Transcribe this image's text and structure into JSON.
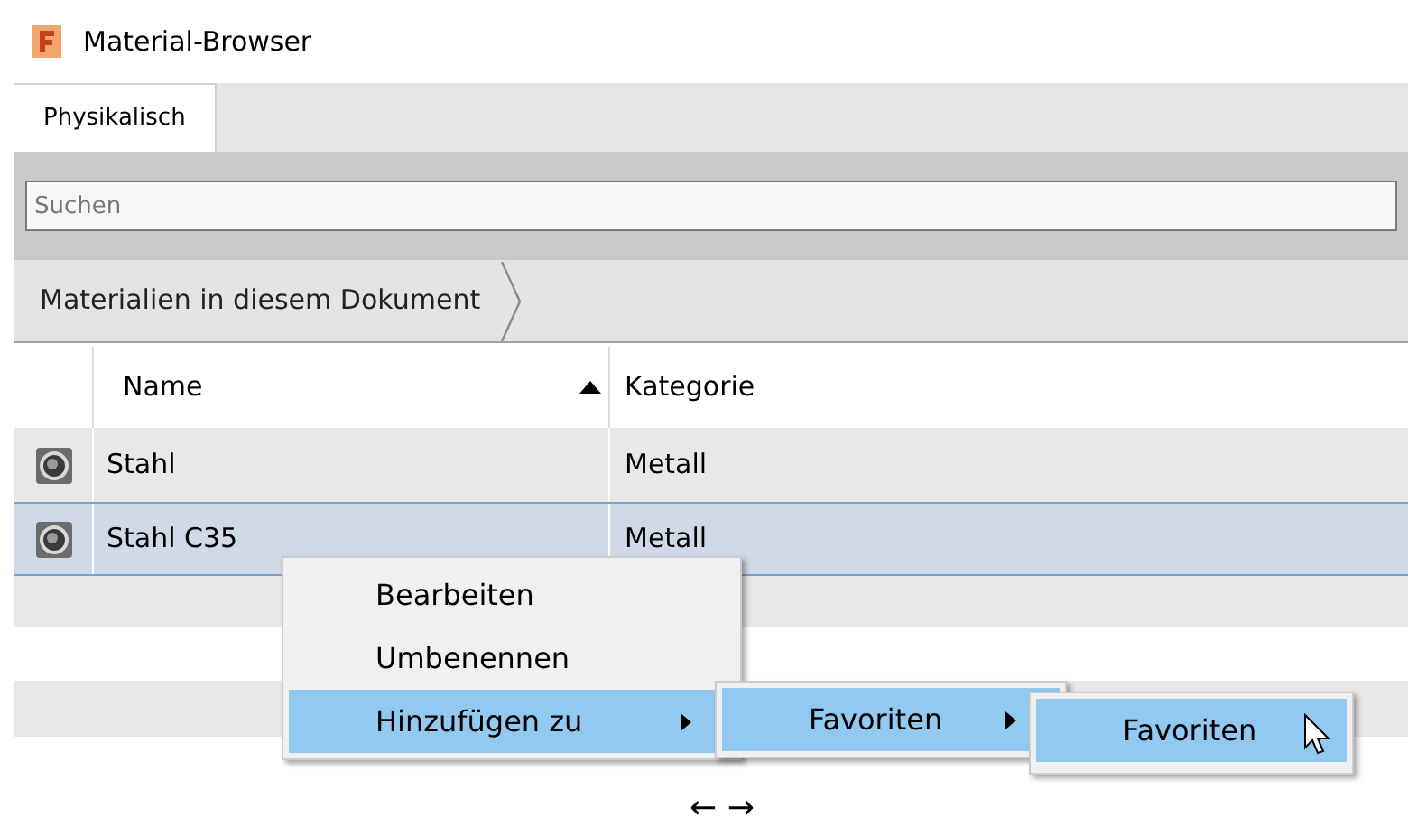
{
  "window": {
    "title": "Material-Browser"
  },
  "tabs": [
    {
      "label": "Physikalisch",
      "selected": true
    }
  ],
  "search": {
    "placeholder": "Suchen"
  },
  "breadcrumb": [
    "Materialien in diesem Dokument"
  ],
  "table": {
    "columns": [
      {
        "label": "Name",
        "sorted_ascending": true
      },
      {
        "label": "Kategorie",
        "sorted_ascending": false
      }
    ],
    "rows": [
      {
        "name": "Stahl",
        "category": "Metall",
        "selected": false
      },
      {
        "name": "Stahl C35",
        "category": "Metall",
        "selected": true
      }
    ]
  },
  "context_menu": {
    "items": [
      {
        "label": "Bearbeiten",
        "selected": false,
        "submenu": false
      },
      {
        "label": "Umbenennen",
        "selected": false,
        "submenu": false
      },
      {
        "label": "Hinzufügen zu",
        "selected": true,
        "submenu": true
      }
    ]
  },
  "submenu": {
    "items": [
      {
        "label": "Favoriten",
        "selected": true,
        "submenu": true
      }
    ]
  },
  "submenu_2": {
    "items": [
      {
        "label": "Favoriten",
        "selected": true,
        "submenu": false
      }
    ]
  },
  "footer": "← →"
}
